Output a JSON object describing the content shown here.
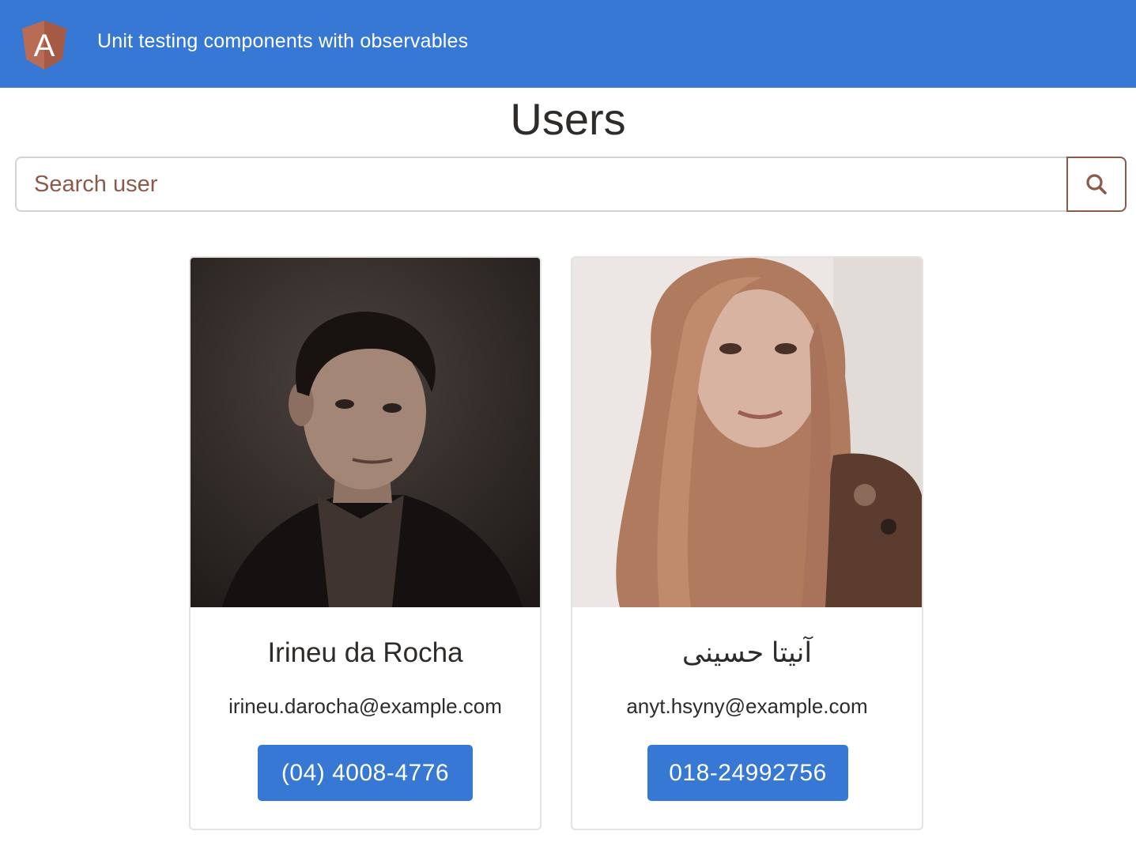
{
  "header": {
    "logo_letter": "A",
    "title": "Unit testing components with observables",
    "color": "#3778d4"
  },
  "page": {
    "title": "Users"
  },
  "search": {
    "placeholder": "Search user",
    "value": "",
    "button_icon": "search-icon"
  },
  "users": [
    {
      "name": "Irineu da Rocha",
      "email": "irineu.darocha@example.com",
      "phone": "(04) 4008-4776",
      "photo": "portrait-man-dark-background"
    },
    {
      "name": "آنیتا حسینی",
      "email": "anyt.hsyny@example.com",
      "phone": "018-24992756",
      "photo": "portrait-woman-light-background"
    }
  ],
  "colors": {
    "accent": "#3778d4",
    "search_border_accent": "#8a5a4b",
    "text": "#2f2b29"
  }
}
